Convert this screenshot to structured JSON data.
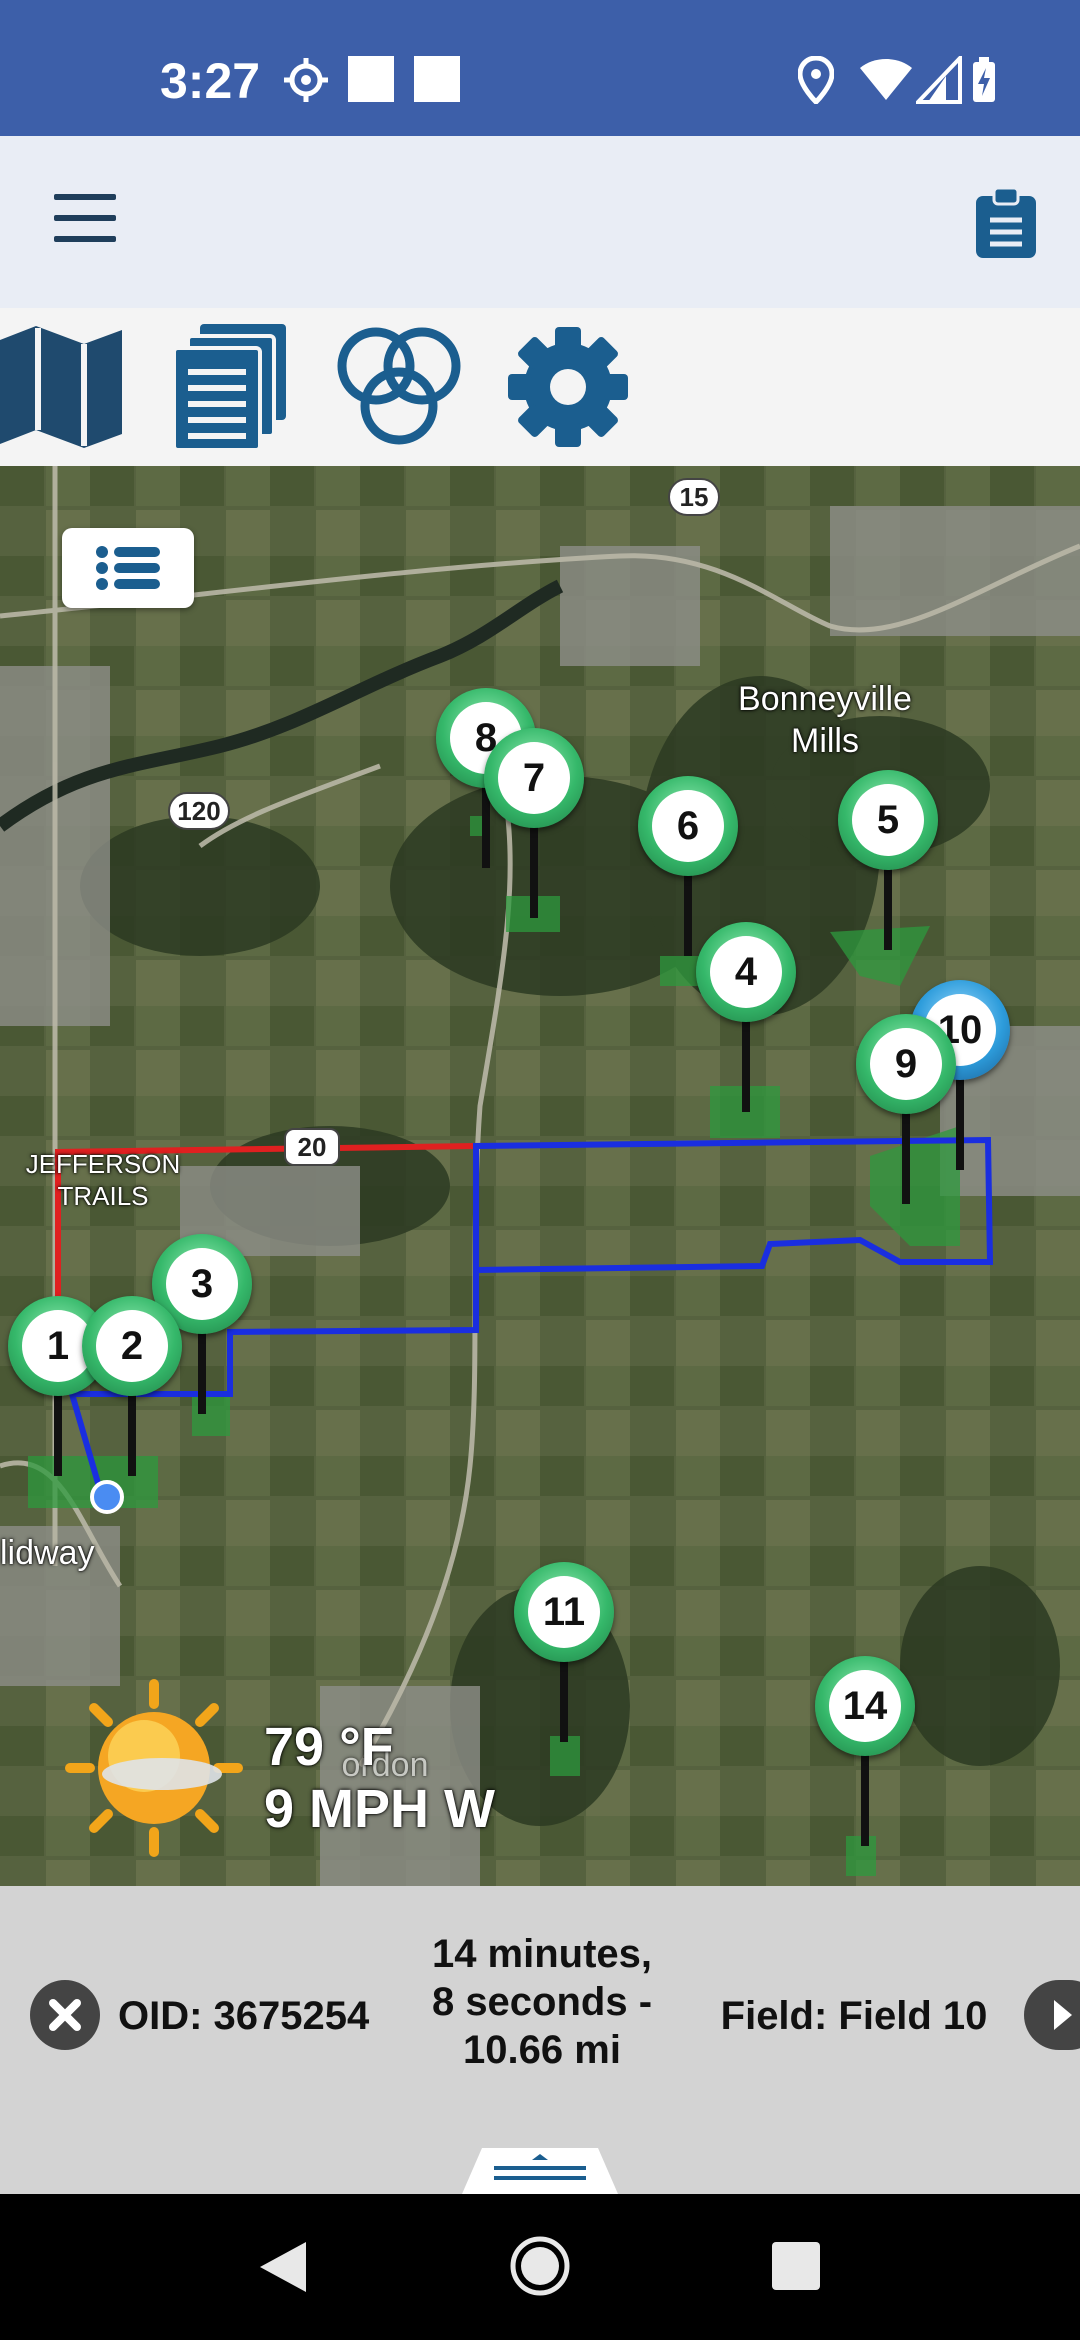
{
  "status_bar": {
    "time": "3:27",
    "icons": [
      "gear-icon",
      "square-icon",
      "square-icon",
      "location-icon",
      "wifi-icon",
      "signal-icon",
      "battery-charging-icon"
    ]
  },
  "header": {
    "menu_icon": "hamburger-menu-icon",
    "clipboard_icon": "clipboard-icon"
  },
  "toolbar": {
    "buttons": [
      "map-icon",
      "documents-icon",
      "layers-circles-icon",
      "settings-gear-icon"
    ],
    "accent_color": "#1b5e8f"
  },
  "map": {
    "labels": {
      "bonneyville": "Bonneyville\nMills",
      "jefferson": "JEFFERSON\nTRAILS",
      "midway": "lidway",
      "town_faded": "ordon"
    },
    "shields": {
      "r15": "15",
      "r120": "120",
      "r20": "20"
    },
    "pins": [
      {
        "num": "1",
        "color": "green"
      },
      {
        "num": "2",
        "color": "green"
      },
      {
        "num": "3",
        "color": "green"
      },
      {
        "num": "4",
        "color": "green"
      },
      {
        "num": "5",
        "color": "green"
      },
      {
        "num": "6",
        "color": "green"
      },
      {
        "num": "7",
        "color": "green"
      },
      {
        "num": "8",
        "color": "green"
      },
      {
        "num": "9",
        "color": "green"
      },
      {
        "num": "10",
        "color": "blue"
      },
      {
        "num": "11",
        "color": "green"
      },
      {
        "num": "14",
        "color": "green"
      }
    ],
    "route_colors": {
      "red": "#e02020",
      "blue": "#1a2ee0"
    },
    "weather": {
      "temp": "79 °F",
      "wind": "9 MPH W",
      "icon": "sun-partly-cloudy-icon"
    }
  },
  "info_panel": {
    "oid": "OID: 3675254",
    "eta_line1": "14 minutes,",
    "eta_line2": "8 seconds -",
    "eta_line3": "10.66 mi",
    "field": "Field: Field 10"
  },
  "nav_bar": {
    "buttons": [
      "back-icon",
      "home-icon",
      "recents-icon"
    ]
  }
}
